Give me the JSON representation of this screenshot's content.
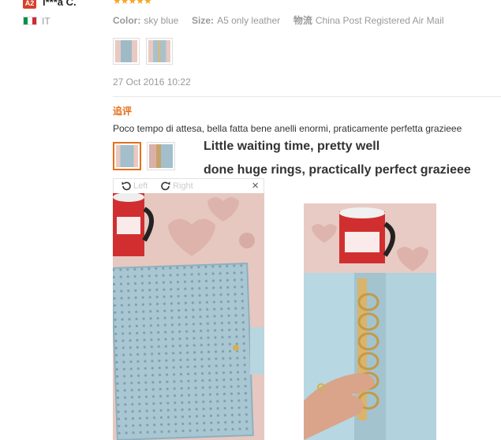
{
  "reviewer": {
    "level_badge": "A2",
    "name": "l***a C.",
    "country": "IT",
    "flag_colors": [
      "#009246",
      "#ffffff",
      "#ce2b37"
    ]
  },
  "review": {
    "stars": "★★★★★",
    "color_label": "Color:",
    "color_value": "sky blue",
    "size_label": "Size:",
    "size_value": "A5 only leather",
    "shipping_label": "物流",
    "shipping_value": "China Post Registered Air Mail",
    "date": "27 Oct 2016 10:22",
    "followup_label": "追评",
    "text": "Poco tempo di attesa, bella fatta bene anelli enormi, praticamente perfetta grazieee"
  },
  "translation": {
    "line1": "Little waiting time, pretty well",
    "line2": "done huge rings, practically perfect grazieee"
  },
  "viewer": {
    "rotate_left_label": "Left",
    "rotate_right_label": "Right",
    "close_symbol": "×"
  },
  "colors": {
    "accent_orange": "#e5701a",
    "badge_red": "#d6402a",
    "star_gold": "#f5a623"
  }
}
